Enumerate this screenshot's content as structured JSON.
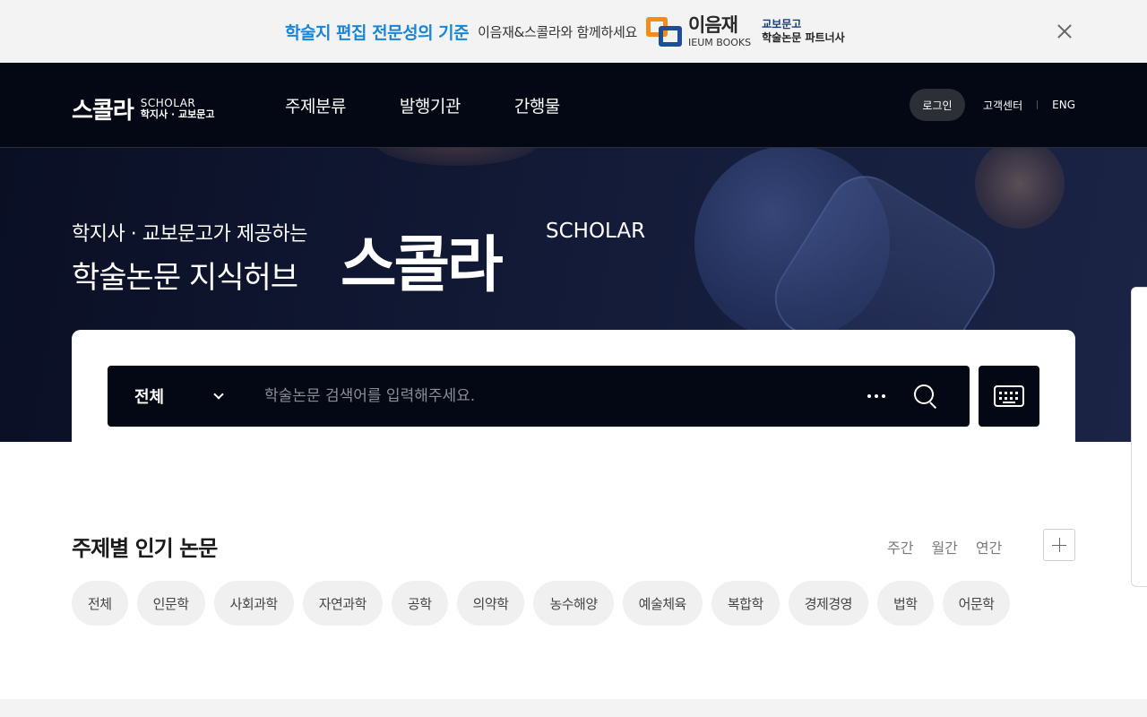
{
  "promo": {
    "highlight": "학술지 편집 전문성의 기준",
    "text": "이음재&스콜라와 함께하세요",
    "brand_ko": "이음재",
    "brand_en": "IEUM BOOKS",
    "partner_top": "교보문고",
    "partner_bottom": "학술논문 파트너사"
  },
  "header": {
    "logo_ko": "스콜라",
    "logo_en": "SCHOLAR",
    "logo_partner": "학지사 · 교보문고",
    "nav": [
      "주제분류",
      "발행기관",
      "간행물"
    ],
    "login": "로그인",
    "customer_center": "고객센터",
    "language": "ENG"
  },
  "hero": {
    "line1": "학지사 · 교보문고가 제공하는",
    "line2": "학술논문 지식허브",
    "brand": "스콜라",
    "brand_en": "SCHOLAR"
  },
  "search": {
    "scope": "전체",
    "placeholder": "학술논문 검색어를 입력해주세요."
  },
  "popular": {
    "title": "주제별 인기 논문",
    "periods": [
      "주간",
      "월간",
      "연간"
    ],
    "categories": [
      "전체",
      "인문학",
      "사회과학",
      "자연과학",
      "공학",
      "의약학",
      "농수해양",
      "예술체육",
      "복합학",
      "경제경영",
      "법학",
      "어문학"
    ]
  },
  "colors": {
    "accent": "#1a86d8",
    "header_bg": "#040815",
    "chip_bg": "#f0f0f0"
  }
}
